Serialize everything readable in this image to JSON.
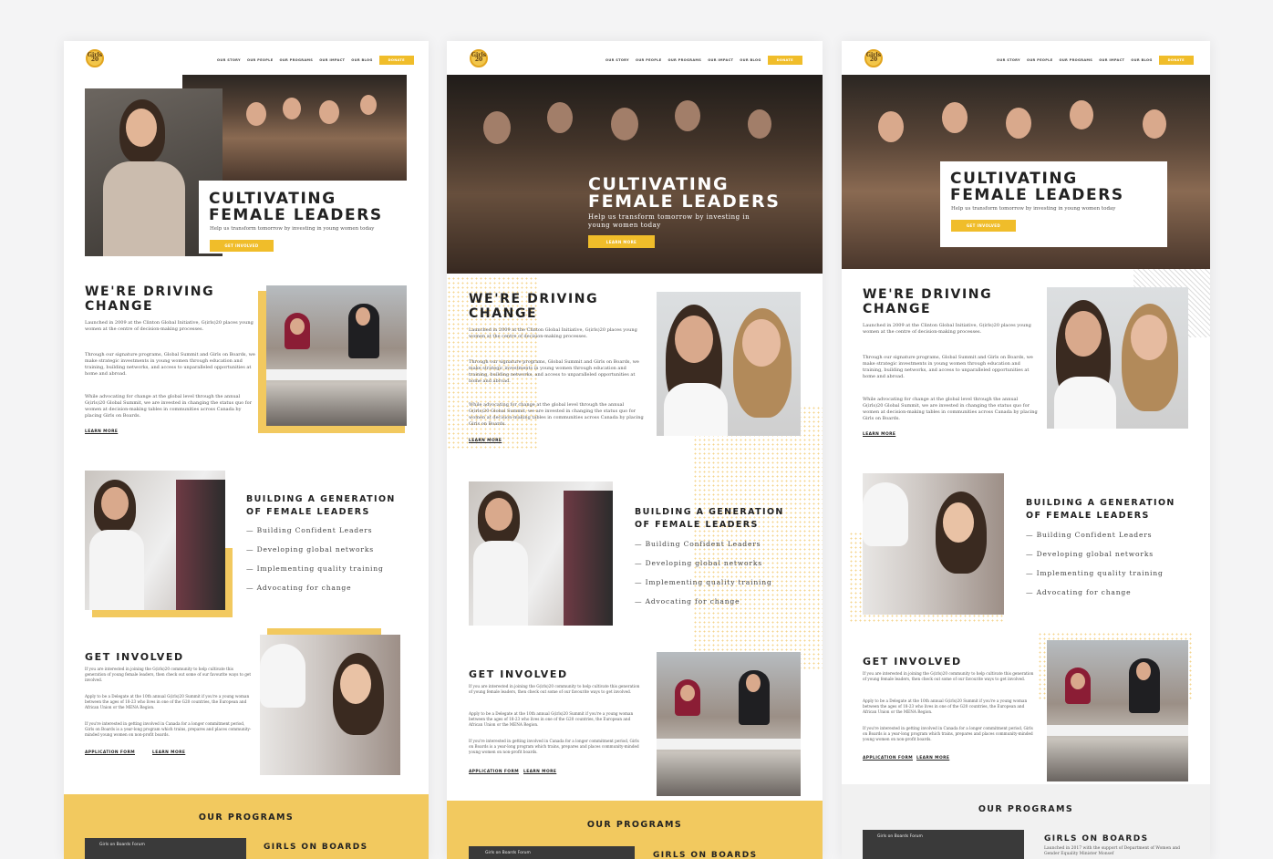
{
  "nav": {
    "items": [
      "OUR STORY",
      "OUR PEOPLE",
      "OUR PROGRAMS",
      "OUR IMPACT",
      "OUR BLOG"
    ],
    "donate": "DONATE"
  },
  "logo_text": "Girls 20",
  "hero": {
    "title_line1": "CULTIVATING",
    "title_line2": "FEMALE LEADERS",
    "subtitle": "Help us transform tomorrow by investing in young women today",
    "cta1": "GET INVOLVED",
    "cta2": "LEARN MORE"
  },
  "driving": {
    "title_line1": "WE'RE DRIVING",
    "title_line2": "CHANGE",
    "p1": "Launched in 2009 at the Clinton Global Initiative, G(irls)20 places young women at the centre of decision-making processes.",
    "p2": "Through our signature programs, Global Summit and Girls on Boards, we make strategic investments in young women through education and training, building networks, and access to unparalleled opportunities at home and abroad.",
    "p3": "While advocating for change at the global level through the annual G(irls)20 Global Summit, we are invested in changing the status quo for women at decision-making tables in communities across Canada by placing Girls on Boards.",
    "link": "LEARN MORE"
  },
  "building": {
    "title_line1": "BUILDING A GENERATION",
    "title_line2": "OF FEMALE LEADERS",
    "bullets": [
      "— Building Confident Leaders",
      "— Developing global networks",
      "— Implementing quality training",
      "— Advocating for change"
    ]
  },
  "involved": {
    "title": "GET INVOLVED",
    "p1": "If you are interested in joining the G(irls)20 community to help cultivate this generation of young female leaders, then check out some of our favourite ways to get involved.",
    "p2": "Apply to be a Delegate at the 10th annual G(irls)20 Summit if you're a young woman between the ages of 18-23 who lives in one of the G20 countries, the European and African Union or the MENA Region.",
    "p3": "If you're interested in getting involved in Canada for a longer commitment period, Girls on Boards is a year-long program which trains, prepares and places community-minded young women on non-profit boards.",
    "link1": "APPLICATION FORM",
    "link2": "LEARN MORE"
  },
  "programs": {
    "title": "OUR PROGRAMS",
    "item": "GIRLS ON BOARDS",
    "video_title": "Girls on Boards Forum",
    "desc": "Launched in 2017 with the support of Department of Women and Gender Equality Minister Monsef"
  },
  "colors": {
    "accent": "#f0bd2a",
    "yellow_band": "#f2c95f",
    "grey_band": "#f1f1f1"
  }
}
